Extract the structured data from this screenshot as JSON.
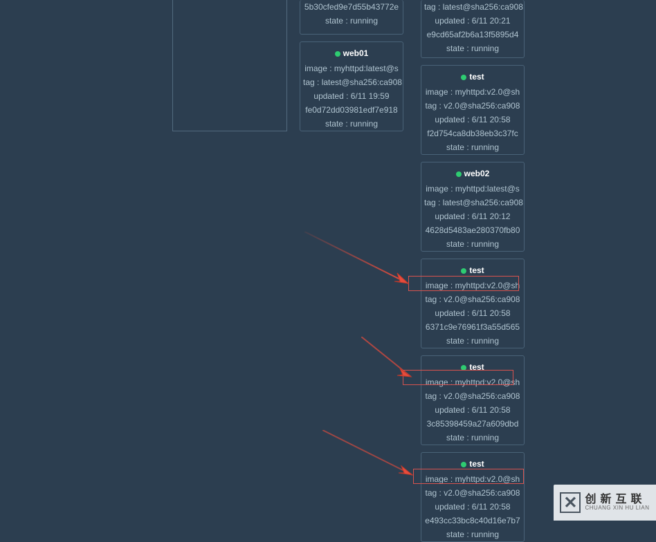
{
  "labels": {
    "image": "image : ",
    "tag": "tag : ",
    "updated": "updated : ",
    "state": "state : "
  },
  "cards": {
    "left_partial": {
      "hash": "5b30cfed9e7d55b43772e",
      "state": "running"
    },
    "web01": {
      "title": "web01",
      "image": "myhttpd:latest@s",
      "tag": "latest@sha256:ca908",
      "updated": "6/11 19:59",
      "hash": "fe0d72dd03981edf7e918",
      "state": "running"
    },
    "right_partial": {
      "tag": "latest@sha256:ca908",
      "updated": "6/11 20:21",
      "hash": "e9cd65af2b6a13f5895d4",
      "state": "running"
    },
    "test1": {
      "title": "test",
      "image": "myhttpd:v2.0@sh",
      "tag": "v2.0@sha256:ca908",
      "updated": "6/11 20:58",
      "hash": "f2d754ca8db38eb3c37fc",
      "state": "running"
    },
    "web02": {
      "title": "web02",
      "image": "myhttpd:latest@s",
      "tag": "latest@sha256:ca908",
      "updated": "6/11 20:12",
      "hash": "4628d5483ae280370fb80",
      "state": "running"
    },
    "test2": {
      "title": "test",
      "image": "myhttpd:v2.0@sh",
      "tag": "v2.0@sha256:ca908",
      "updated": "6/11 20:58",
      "hash": "6371c9e76961f3a55d565",
      "state": "running"
    },
    "test3": {
      "title": "test",
      "image": "myhttpd:v2.0@sh",
      "tag": "v2.0@sha256:ca908",
      "updated": "6/11 20:58",
      "hash": "3c85398459a27a609dbd",
      "state": "running"
    },
    "test4": {
      "title": "test",
      "image": "myhttpd:v2.0@sh",
      "tag": "v2.0@sha256:ca908",
      "updated": "6/11 20:58",
      "hash": "e493cc33bc8c40d16e7b7",
      "state": "running"
    }
  },
  "watermark": {
    "cn": "创新互联",
    "en": "CHUANG XIN HU LIAN"
  }
}
